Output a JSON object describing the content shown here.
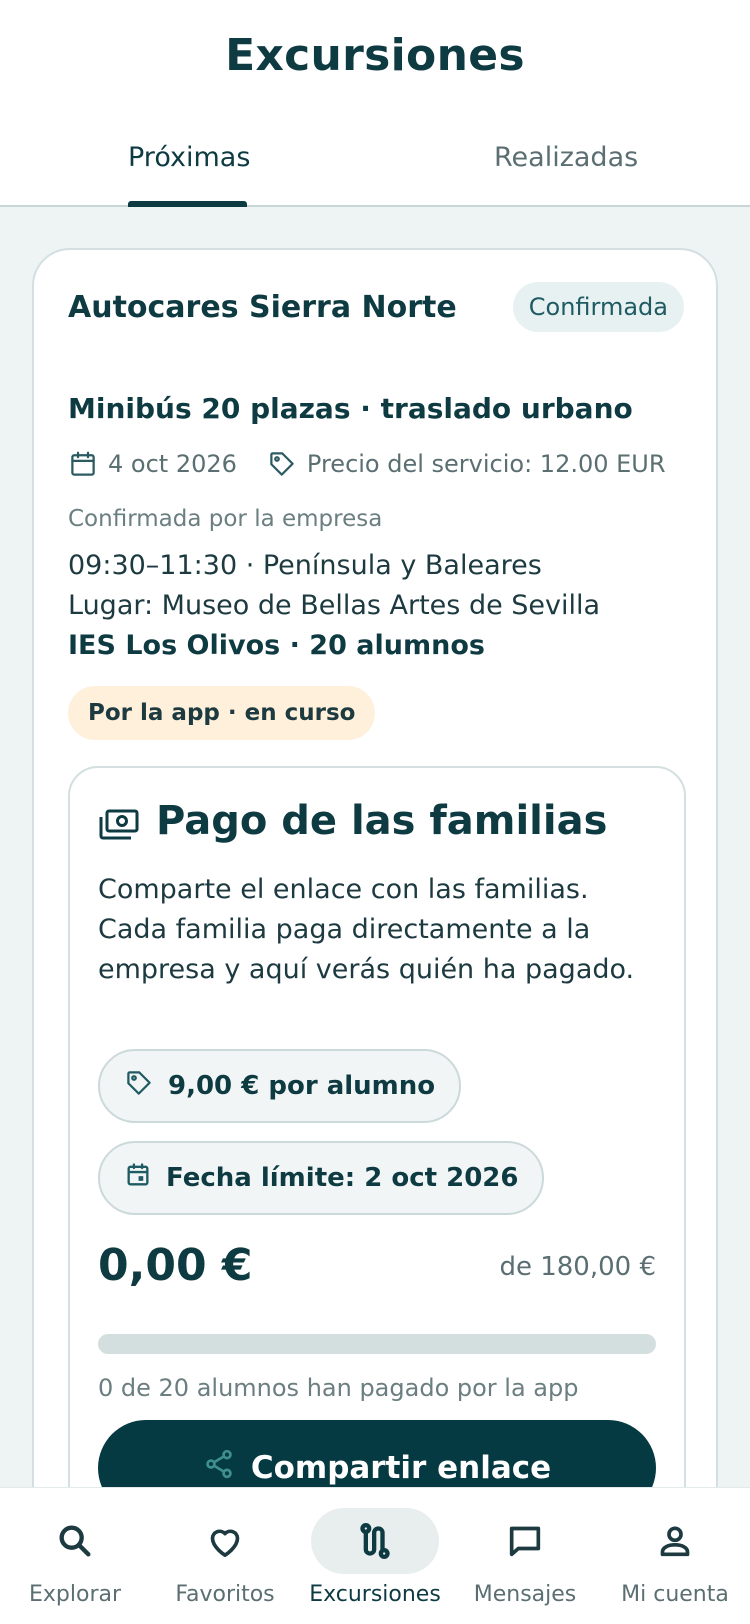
{
  "header": {
    "title": "Excursiones",
    "tabs": [
      {
        "label": "Próximas",
        "active": true
      },
      {
        "label": "Realizadas",
        "active": false
      }
    ]
  },
  "booking": {
    "company": "Autocares Sierra Norte",
    "status": "Confirmada",
    "service": "Minibús 20 plazas · traslado urbano",
    "date": "4 oct 2026",
    "price": "Precio del servicio: 12.00 EUR",
    "confirmation_note": "Confirmada por la empresa",
    "time_region": "09:30–11:30 · Península y Baleares",
    "place": "Lugar: Museo de Bellas Artes de Sevilla",
    "school": "IES Los Olivos · 20 alumnos",
    "payment_mode": "Por la app · en curso"
  },
  "payment": {
    "title": "Pago de las familias",
    "description": "Comparte el enlace con las familias. Cada familia paga directamente a la empresa y aquí verás quién ha pagado.",
    "per_student": "9,00 € por alumno",
    "deadline": "Fecha límite: 2 oct 2026",
    "collected": "0,00 €",
    "total": "de 180,00 €",
    "progress_fraction": 0,
    "progress_note": "0 de 20 alumnos han pagado por la app",
    "share_label": "Compartir enlace"
  },
  "nav": {
    "items": [
      {
        "label": "Explorar",
        "icon": "search-icon",
        "active": false
      },
      {
        "label": "Favoritos",
        "icon": "heart-icon",
        "active": false
      },
      {
        "label": "Excursiones",
        "icon": "route-icon",
        "active": true
      },
      {
        "label": "Mensajes",
        "icon": "chat-icon",
        "active": false
      },
      {
        "label": "Mi cuenta",
        "icon": "account-icon",
        "active": false
      }
    ]
  },
  "colors": {
    "primary": "#0e3a42",
    "background": "#eef4f4",
    "status_chip_bg": "#e8f1f1",
    "app_chip_bg": "#fff0dc",
    "button": "#053a42"
  }
}
